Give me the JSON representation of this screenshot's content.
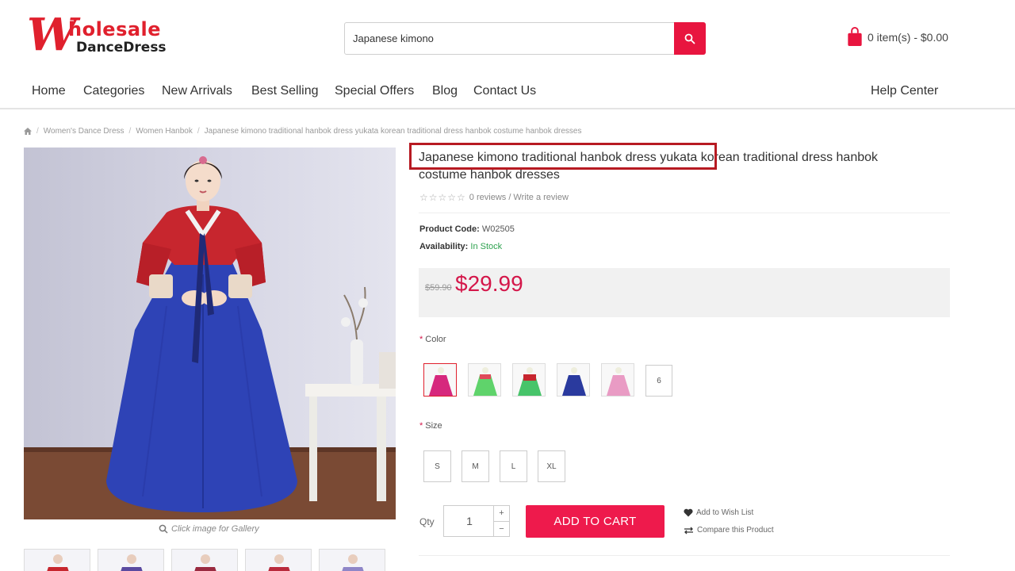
{
  "header": {
    "logo_big_letter": "W",
    "logo_line1": "holesale",
    "logo_line2": "DanceDress",
    "search_value": "Japanese kimono",
    "cart_text": "0 item(s) - $0.00"
  },
  "nav": {
    "items": [
      "Home",
      "Categories",
      "New Arrivals",
      "Best Selling",
      "Special Offers",
      "Blog",
      "Contact Us"
    ],
    "help": "Help Center"
  },
  "breadcrumb": {
    "items": [
      "Women's Dance Dress",
      "Women Hanbok",
      "Japanese kimono traditional hanbok dress yukata korean traditional dress hanbok costume hanbok dresses"
    ]
  },
  "product": {
    "title": "Japanese kimono traditional hanbok dress yukata korean traditional dress hanbok costume hanbok dresses",
    "reviews": "0 reviews / Write a review",
    "code_label": "Product Code:",
    "code_value": "W02505",
    "availability_label": "Availability:",
    "availability_value": "In Stock",
    "old_price": "$59.90",
    "price": "$29.99",
    "gallery_hint": "Click image for Gallery"
  },
  "options": {
    "color_label": "Color",
    "color_swatches": [
      {
        "name": "magenta",
        "color": "#d6287d"
      },
      {
        "name": "green",
        "color": "#5fd36b"
      },
      {
        "name": "red-green",
        "color": "#47c46a"
      },
      {
        "name": "blue",
        "color": "#2a3a9e"
      },
      {
        "name": "pink",
        "color": "#e99bc4"
      }
    ],
    "color_more": "6",
    "size_label": "Size",
    "sizes": [
      "S",
      "M",
      "L",
      "XL"
    ]
  },
  "cart_form": {
    "qty_label": "Qty",
    "qty_value": "1",
    "plus": "+",
    "minus": "−",
    "add_to_cart": "ADD TO CART",
    "wish_list": "Add to Wish List",
    "compare": "Compare this Product"
  },
  "colors": {
    "brand_red": "#e0202d",
    "accent_pink": "#ee1a4c",
    "price": "#d4174a",
    "in_stock": "#2ea24f",
    "highlight_box": "#b71a22"
  }
}
